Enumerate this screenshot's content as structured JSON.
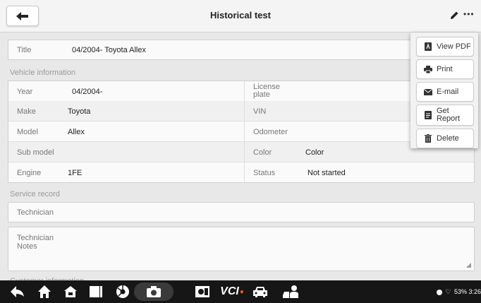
{
  "header": {
    "title": "Historical test"
  },
  "title_field": {
    "label": "Title",
    "value": "04/2004- Toyota Allex"
  },
  "vehicle_section": {
    "heading": "Vehicle information",
    "left": [
      {
        "label": "Year",
        "value": "04/2004-"
      },
      {
        "label": "Make",
        "value": "Toyota"
      },
      {
        "label": "Model",
        "value": "Allex"
      },
      {
        "label": "Sub model",
        "value": ""
      },
      {
        "label": "Engine",
        "value": "1FE"
      }
    ],
    "right": [
      {
        "label": "License plate",
        "value": ""
      },
      {
        "label": "VIN",
        "value": ""
      },
      {
        "label": "Odometer",
        "value": ""
      },
      {
        "label": "Color",
        "value": "Color"
      },
      {
        "label": "Status",
        "value": "Not started"
      }
    ]
  },
  "service_section": {
    "heading": "Service record",
    "technician_label": "Technician",
    "notes_label_line1": "Technician",
    "notes_label_line2": "Notes"
  },
  "customer_section": {
    "heading": "Customer information"
  },
  "menu": {
    "items": [
      {
        "label": "View PDF",
        "icon": "pdf-icon"
      },
      {
        "label": "Print",
        "icon": "print-icon"
      },
      {
        "label": "E-mail",
        "icon": "email-icon"
      },
      {
        "label_line1": "Get",
        "label_line2": "Report",
        "icon": "report-icon"
      },
      {
        "label": "Delete",
        "icon": "trash-icon"
      }
    ]
  },
  "navbar": {
    "vci_label": "VCI",
    "status_text": "53% 3:26"
  }
}
